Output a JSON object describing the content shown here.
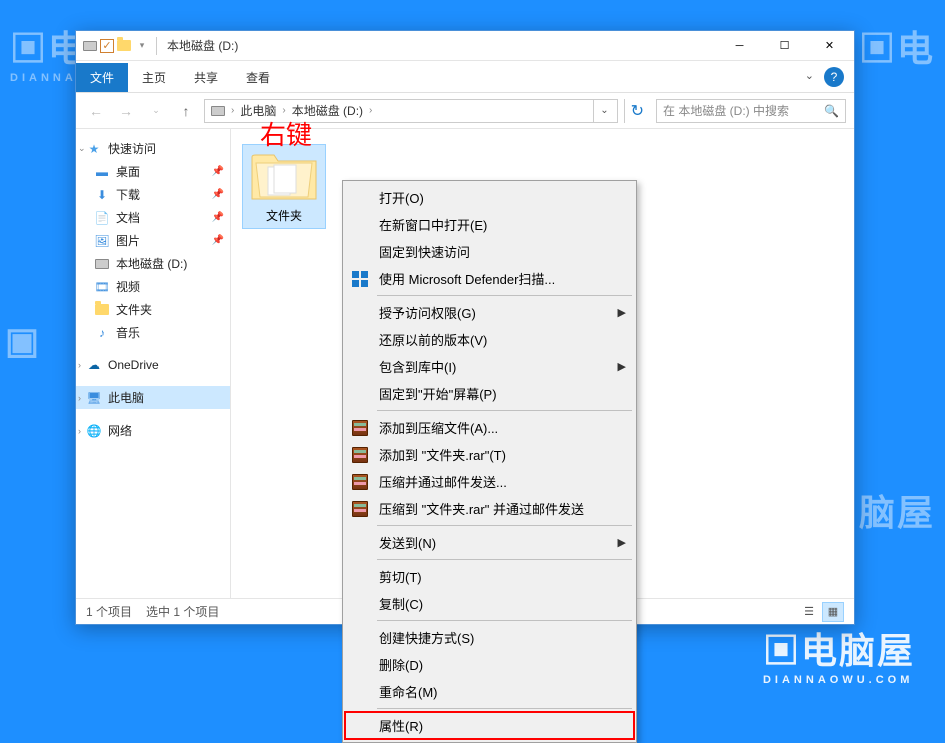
{
  "titlebar": {
    "title": "本地磁盘 (D:)"
  },
  "ribbon": {
    "tabs": {
      "file": "文件",
      "home": "主页",
      "share": "共享",
      "view": "查看"
    }
  },
  "breadcrumb": {
    "pc": "此电脑",
    "drive": "本地磁盘 (D:)"
  },
  "search": {
    "placeholder": "在 本地磁盘 (D:) 中搜索"
  },
  "sidebar": {
    "quickaccess": "快速访问",
    "desktop": "桌面",
    "downloads": "下载",
    "documents": "文档",
    "pictures": "图片",
    "driveD": "本地磁盘 (D:)",
    "videos": "视频",
    "folder": "文件夹",
    "music": "音乐",
    "onedrive": "OneDrive",
    "thispc": "此电脑",
    "network": "网络"
  },
  "content": {
    "folder_name": "文件夹"
  },
  "annotation": "右键",
  "statusbar": {
    "count": "1 个项目",
    "selected": "选中 1 个项目"
  },
  "context_menu": {
    "open": "打开(O)",
    "open_new": "在新窗口中打开(E)",
    "pin_quick": "固定到快速访问",
    "defender": "使用 Microsoft Defender扫描...",
    "grant_access": "授予访问权限(G)",
    "restore": "还原以前的版本(V)",
    "include_lib": "包含到库中(I)",
    "pin_start": "固定到\"开始\"屏幕(P)",
    "add_archive": "添加到压缩文件(A)...",
    "add_rar": "添加到 \"文件夹.rar\"(T)",
    "compress_email": "压缩并通过邮件发送...",
    "compress_rar_email": "压缩到 \"文件夹.rar\" 并通过邮件发送",
    "send_to": "发送到(N)",
    "cut": "剪切(T)",
    "copy": "复制(C)",
    "shortcut": "创建快捷方式(S)",
    "delete": "删除(D)",
    "rename": "重命名(M)",
    "properties": "属性(R)"
  }
}
